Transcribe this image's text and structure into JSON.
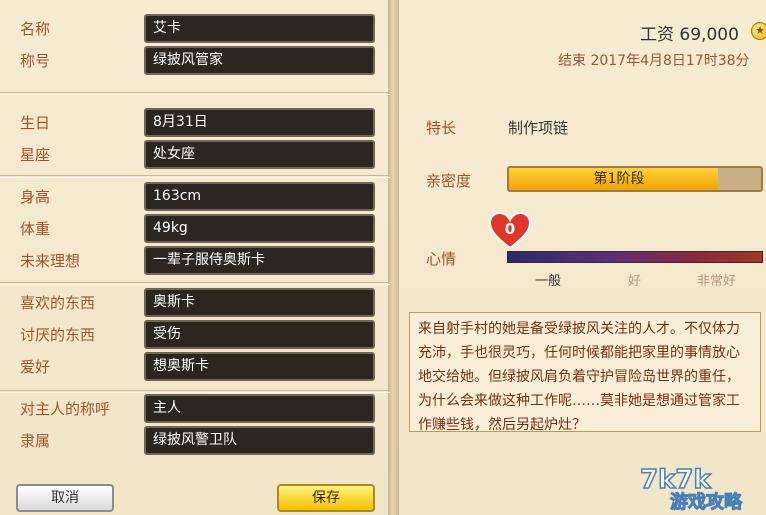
{
  "profile": {
    "name_label": "名称",
    "name_value": "艾卡",
    "title_label": "称号",
    "title_value": "绿披风管家",
    "birthday_label": "生日",
    "birthday_value": "8月31日",
    "zodiac_label": "星座",
    "zodiac_value": "处女座",
    "height_label": "身高",
    "height_value": "163cm",
    "weight_label": "体重",
    "weight_value": "49kg",
    "dream_label": "未来理想",
    "dream_value": "一辈子服侍奥斯卡",
    "likes_label": "喜欢的东西",
    "likes_value": "奥斯卡",
    "dislikes_label": "讨厌的东西",
    "dislikes_value": "受伤",
    "hobby_label": "爱好",
    "hobby_value": "想奥斯卡",
    "master_call_label": "对主人的称呼",
    "master_call_value": "主人",
    "affiliation_label": "隶属",
    "affiliation_value": "绿披风警卫队"
  },
  "buttons": {
    "cancel": "取消",
    "save": "保存"
  },
  "status": {
    "salary": "工资 69,000",
    "end_time": "结束 2017年4月8日17时38分",
    "specialty_label": "特长",
    "specialty_value": "制作项链",
    "affinity_label": "亲密度",
    "affinity_stage": "第1阶段",
    "affinity_fill_fraction": 0.83,
    "mood_label": "心情",
    "mood_value": "0",
    "mood_levels": [
      "一般",
      "好",
      "非常好"
    ],
    "description": "来自射手村的她是备受绿披风关注的人才。不仅体力充沛，手也很灵巧，任何时候都能把家里的事情放心地交给她。但绿披风肩负着守护冒险岛世界的重任，为什么会来做这种工作呢……莫非她是想通过管家工作赚些钱，然后另起炉灶？"
  },
  "icons": {
    "coin": "coin-icon",
    "heart": "heart-icon"
  },
  "watermark": {
    "text": "游戏攻略"
  },
  "colors": {
    "label": "#a5512d",
    "field_bg": "#2c2520",
    "save_button": "#f2c100",
    "heart": "#e0352b"
  }
}
